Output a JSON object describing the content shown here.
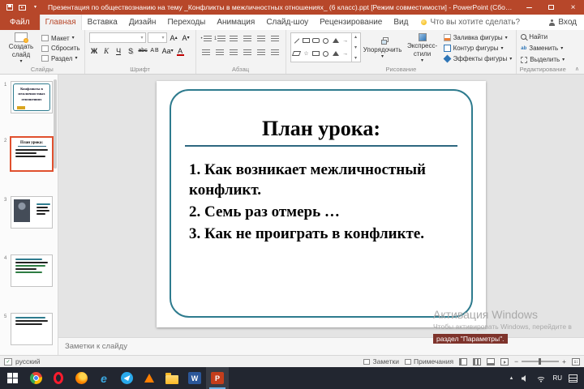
{
  "titlebar": {
    "title": "Презентация по обществознанию на тему _Конфликты в межличностных отношениях_ (6 класс).ppt [Режим совместимости] - PowerPoint (Сбой активации продукта)"
  },
  "icons": {
    "close": "×",
    "dropdown": "▾",
    "scroll_up": "▴",
    "scroll_down": "▾",
    "arrow": "→",
    "star": "☆",
    "collapse": "∧",
    "check": "✓",
    "zoom_out": "−",
    "zoom_in": "+",
    "bullet": "•",
    "one": "1",
    "tray_up": "▲",
    "word_letter": "W",
    "ppt_letter": "P",
    "edge_letter": "e",
    "replace_ab": "ab"
  },
  "tabs": {
    "file": "Файл",
    "items": [
      "Главная",
      "Вставка",
      "Дизайн",
      "Переходы",
      "Анимация",
      "Слайд-шоу",
      "Рецензирование",
      "Вид"
    ],
    "tell_me": "Что вы хотите сделать?",
    "sign_in": "Вход"
  },
  "ribbon": {
    "slides": {
      "label": "Слайды",
      "new_slide": "Создать слайд",
      "layout": "Макет",
      "reset": "Сбросить",
      "section": "Раздел"
    },
    "font": {
      "label": "Шрифт",
      "bold": "Ж",
      "italic": "К",
      "underline": "Ч",
      "shadow": "S",
      "strikethrough": "abc",
      "char_spacing": "АВ",
      "change_case": "Аа",
      "font_color": "А"
    },
    "paragraph": {
      "label": "Абзац"
    },
    "drawing": {
      "label": "Рисование",
      "arrange": "Упорядочить",
      "quick_styles": "Экспресс-стили",
      "shape_fill": "Заливка фигуры",
      "shape_outline": "Контур фигуры",
      "shape_effects": "Эффекты фигуры"
    },
    "editing": {
      "label": "Редактирование",
      "find": "Найти",
      "replace": "Заменить",
      "select": "Выделить"
    }
  },
  "thumbnails": [
    {
      "number": "1",
      "lines": [
        "Конфликты в",
        "межличностных",
        "отношениях"
      ]
    },
    {
      "number": "2",
      "title": "План урока:",
      "selected": true
    },
    {
      "number": "3"
    },
    {
      "number": "4"
    },
    {
      "number": "5"
    }
  ],
  "slide": {
    "title": "План урока:",
    "items": [
      "1. Как возникает межличностный конфликт.",
      "2. Семь раз отмерь …",
      "3. Как не проиграть в конфликте."
    ]
  },
  "notes": {
    "placeholder": "Заметки к слайду"
  },
  "statusbar": {
    "language": "русский",
    "notes": "Заметки",
    "comments": "Примечания"
  },
  "watermark": {
    "line1": "Активация Windows",
    "line2": "Чтобы активировать Windows, перейдите в",
    "line3": "раздел \"Параметры\"."
  },
  "taskbar": {
    "language": "RU"
  },
  "colors": {
    "accent": "#b7472a",
    "slide_border": "#2e7b8e",
    "selection_border": "#e0502e",
    "watermark_banner": "#7e332b"
  }
}
